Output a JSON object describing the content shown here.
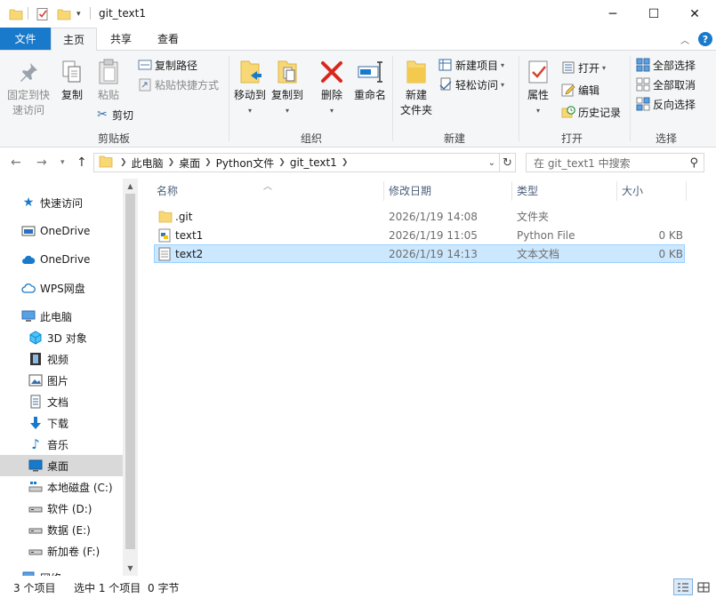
{
  "window": {
    "title": "git_text1"
  },
  "tabs": {
    "file": "文件",
    "home": "主页",
    "share": "共享",
    "view": "查看"
  },
  "ribbon": {
    "clipboard": {
      "label": "剪贴板",
      "pin_line1": "固定到快",
      "pin_line2": "速访问",
      "copy": "复制",
      "paste": "粘贴",
      "copy_path": "复制路径",
      "paste_shortcut": "粘贴快捷方式",
      "cut": "剪切"
    },
    "organize": {
      "label": "组织",
      "move_to": "移动到",
      "copy_to": "复制到",
      "delete": "删除",
      "rename": "重命名"
    },
    "new": {
      "label": "新建",
      "new_folder_line1": "新建",
      "new_folder_line2": "文件夹",
      "new_item": "新建项目",
      "easy_access": "轻松访问"
    },
    "open": {
      "label": "打开",
      "properties": "属性",
      "open": "打开",
      "edit": "编辑",
      "history": "历史记录"
    },
    "select": {
      "label": "选择",
      "select_all": "全部选择",
      "select_none": "全部取消",
      "invert": "反向选择"
    }
  },
  "address": {
    "crumbs": [
      "此电脑",
      "桌面",
      "Python文件",
      "git_text1"
    ],
    "search_placeholder": "在 git_text1 中搜索"
  },
  "nav": {
    "quick_access": "快速访问",
    "onedrive1": "OneDrive",
    "onedrive2": "OneDrive",
    "wps": "WPS网盘",
    "this_pc": "此电脑",
    "objects3d": "3D 对象",
    "videos": "视频",
    "pictures": "图片",
    "documents": "文档",
    "downloads": "下载",
    "music": "音乐",
    "desktop": "桌面",
    "disk_c": "本地磁盘 (C:)",
    "disk_d": "软件 (D:)",
    "disk_e": "数据 (E:)",
    "disk_f": "新加卷 (F:)",
    "network": "网络"
  },
  "columns": {
    "name": "名称",
    "modified": "修改日期",
    "type": "类型",
    "size": "大小"
  },
  "files": [
    {
      "name": ".git",
      "modified": "2026/1/19 14:08",
      "type": "文件夹",
      "size": ""
    },
    {
      "name": "text1",
      "modified": "2026/1/19 11:05",
      "type": "Python File",
      "size": "0 KB"
    },
    {
      "name": "text2",
      "modified": "2026/1/19 14:13",
      "type": "文本文档",
      "size": "0 KB"
    }
  ],
  "status": {
    "count": "3 个项目",
    "selected": "选中 1 个项目",
    "size": "0 字节"
  },
  "colors": {
    "accent": "#1979ca",
    "selection": "#cce8ff",
    "selection_border": "#99d1ff",
    "folder": "#f8d775"
  }
}
